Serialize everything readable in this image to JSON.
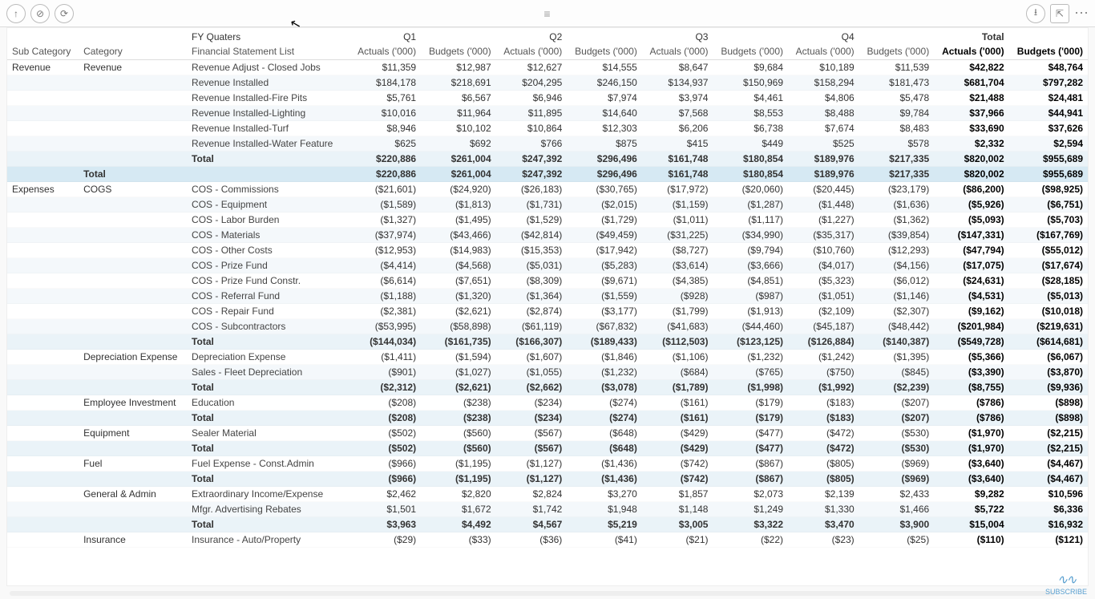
{
  "toolbar": {
    "up_icon": "↑",
    "refresh_icon": "⟳",
    "back_icon": "⊘",
    "drag_handle": "≡",
    "download_icon": "⭳",
    "popout_icon": "⇱",
    "more_icon": "⋯"
  },
  "header": {
    "fy_label": "FY Quaters",
    "fin_label": "Financial Statement List",
    "sub_category": "Sub Category",
    "category": "Category",
    "q1": "Q1",
    "q2": "Q2",
    "q3": "Q3",
    "q4": "Q4",
    "total": "Total",
    "actuals": "Actuals ('000)",
    "budgets": "Budgets ('000)"
  },
  "total_label": "Total",
  "groups": [
    {
      "sub": "Revenue",
      "categories": [
        {
          "cat": "Revenue",
          "rows": [
            {
              "name": "Revenue Adjust - Closed Jobs",
              "q1a": "$11,359",
              "q1b": "$12,987",
              "q2a": "$12,627",
              "q2b": "$14,555",
              "q3a": "$8,647",
              "q3b": "$9,684",
              "q4a": "$10,189",
              "q4b": "$11,539",
              "ta": "$42,822",
              "tb": "$48,764"
            },
            {
              "name": "Revenue Installed",
              "q1a": "$184,178",
              "q1b": "$218,691",
              "q2a": "$204,295",
              "q2b": "$246,150",
              "q3a": "$134,937",
              "q3b": "$150,969",
              "q4a": "$158,294",
              "q4b": "$181,473",
              "ta": "$681,704",
              "tb": "$797,282"
            },
            {
              "name": "Revenue Installed-Fire Pits",
              "q1a": "$5,761",
              "q1b": "$6,567",
              "q2a": "$6,946",
              "q2b": "$7,974",
              "q3a": "$3,974",
              "q3b": "$4,461",
              "q4a": "$4,806",
              "q4b": "$5,478",
              "ta": "$21,488",
              "tb": "$24,481"
            },
            {
              "name": "Revenue Installed-Lighting",
              "q1a": "$10,016",
              "q1b": "$11,964",
              "q2a": "$11,895",
              "q2b": "$14,640",
              "q3a": "$7,568",
              "q3b": "$8,553",
              "q4a": "$8,488",
              "q4b": "$9,784",
              "ta": "$37,966",
              "tb": "$44,941"
            },
            {
              "name": "Revenue Installed-Turf",
              "q1a": "$8,946",
              "q1b": "$10,102",
              "q2a": "$10,864",
              "q2b": "$12,303",
              "q3a": "$6,206",
              "q3b": "$6,738",
              "q4a": "$7,674",
              "q4b": "$8,483",
              "ta": "$33,690",
              "tb": "$37,626"
            },
            {
              "name": "Revenue Installed-Water Feature",
              "q1a": "$625",
              "q1b": "$692",
              "q2a": "$766",
              "q2b": "$875",
              "q3a": "$415",
              "q3b": "$449",
              "q4a": "$525",
              "q4b": "$578",
              "ta": "$2,332",
              "tb": "$2,594"
            }
          ],
          "total": {
            "q1a": "$220,886",
            "q1b": "$261,004",
            "q2a": "$247,392",
            "q2b": "$296,496",
            "q3a": "$161,748",
            "q3b": "$180,854",
            "q4a": "$189,976",
            "q4b": "$217,335",
            "ta": "$820,002",
            "tb": "$955,689"
          }
        }
      ],
      "total": {
        "q1a": "$220,886",
        "q1b": "$261,004",
        "q2a": "$247,392",
        "q2b": "$296,496",
        "q3a": "$161,748",
        "q3b": "$180,854",
        "q4a": "$189,976",
        "q4b": "$217,335",
        "ta": "$820,002",
        "tb": "$955,689"
      }
    },
    {
      "sub": "Expenses",
      "categories": [
        {
          "cat": "COGS",
          "rows": [
            {
              "name": "COS - Commissions",
              "q1a": "($21,601)",
              "q1b": "($24,920)",
              "q2a": "($26,183)",
              "q2b": "($30,765)",
              "q3a": "($17,972)",
              "q3b": "($20,060)",
              "q4a": "($20,445)",
              "q4b": "($23,179)",
              "ta": "($86,200)",
              "tb": "($98,925)"
            },
            {
              "name": "COS - Equipment",
              "q1a": "($1,589)",
              "q1b": "($1,813)",
              "q2a": "($1,731)",
              "q2b": "($2,015)",
              "q3a": "($1,159)",
              "q3b": "($1,287)",
              "q4a": "($1,448)",
              "q4b": "($1,636)",
              "ta": "($5,926)",
              "tb": "($6,751)"
            },
            {
              "name": "COS - Labor Burden",
              "q1a": "($1,327)",
              "q1b": "($1,495)",
              "q2a": "($1,529)",
              "q2b": "($1,729)",
              "q3a": "($1,011)",
              "q3b": "($1,117)",
              "q4a": "($1,227)",
              "q4b": "($1,362)",
              "ta": "($5,093)",
              "tb": "($5,703)"
            },
            {
              "name": "COS - Materials",
              "q1a": "($37,974)",
              "q1b": "($43,466)",
              "q2a": "($42,814)",
              "q2b": "($49,459)",
              "q3a": "($31,225)",
              "q3b": "($34,990)",
              "q4a": "($35,317)",
              "q4b": "($39,854)",
              "ta": "($147,331)",
              "tb": "($167,769)"
            },
            {
              "name": "COS - Other Costs",
              "q1a": "($12,953)",
              "q1b": "($14,983)",
              "q2a": "($15,353)",
              "q2b": "($17,942)",
              "q3a": "($8,727)",
              "q3b": "($9,794)",
              "q4a": "($10,760)",
              "q4b": "($12,293)",
              "ta": "($47,794)",
              "tb": "($55,012)"
            },
            {
              "name": "COS - Prize Fund",
              "q1a": "($4,414)",
              "q1b": "($4,568)",
              "q2a": "($5,031)",
              "q2b": "($5,283)",
              "q3a": "($3,614)",
              "q3b": "($3,666)",
              "q4a": "($4,017)",
              "q4b": "($4,156)",
              "ta": "($17,075)",
              "tb": "($17,674)"
            },
            {
              "name": "COS - Prize Fund Constr.",
              "q1a": "($6,614)",
              "q1b": "($7,651)",
              "q2a": "($8,309)",
              "q2b": "($9,671)",
              "q3a": "($4,385)",
              "q3b": "($4,851)",
              "q4a": "($5,323)",
              "q4b": "($6,012)",
              "ta": "($24,631)",
              "tb": "($28,185)"
            },
            {
              "name": "COS - Referral Fund",
              "q1a": "($1,188)",
              "q1b": "($1,320)",
              "q2a": "($1,364)",
              "q2b": "($1,559)",
              "q3a": "($928)",
              "q3b": "($987)",
              "q4a": "($1,051)",
              "q4b": "($1,146)",
              "ta": "($4,531)",
              "tb": "($5,013)"
            },
            {
              "name": "COS - Repair Fund",
              "q1a": "($2,381)",
              "q1b": "($2,621)",
              "q2a": "($2,874)",
              "q2b": "($3,177)",
              "q3a": "($1,799)",
              "q3b": "($1,913)",
              "q4a": "($2,109)",
              "q4b": "($2,307)",
              "ta": "($9,162)",
              "tb": "($10,018)"
            },
            {
              "name": "COS - Subcontractors",
              "q1a": "($53,995)",
              "q1b": "($58,898)",
              "q2a": "($61,119)",
              "q2b": "($67,832)",
              "q3a": "($41,683)",
              "q3b": "($44,460)",
              "q4a": "($45,187)",
              "q4b": "($48,442)",
              "ta": "($201,984)",
              "tb": "($219,631)"
            }
          ],
          "total": {
            "q1a": "($144,034)",
            "q1b": "($161,735)",
            "q2a": "($166,307)",
            "q2b": "($189,433)",
            "q3a": "($112,503)",
            "q3b": "($123,125)",
            "q4a": "($126,884)",
            "q4b": "($140,387)",
            "ta": "($549,728)",
            "tb": "($614,681)"
          }
        },
        {
          "cat": "Depreciation Expense",
          "rows": [
            {
              "name": "Depreciation Expense",
              "q1a": "($1,411)",
              "q1b": "($1,594)",
              "q2a": "($1,607)",
              "q2b": "($1,846)",
              "q3a": "($1,106)",
              "q3b": "($1,232)",
              "q4a": "($1,242)",
              "q4b": "($1,395)",
              "ta": "($5,366)",
              "tb": "($6,067)"
            },
            {
              "name": "Sales - Fleet Depreciation",
              "q1a": "($901)",
              "q1b": "($1,027)",
              "q2a": "($1,055)",
              "q2b": "($1,232)",
              "q3a": "($684)",
              "q3b": "($765)",
              "q4a": "($750)",
              "q4b": "($845)",
              "ta": "($3,390)",
              "tb": "($3,870)"
            }
          ],
          "total": {
            "q1a": "($2,312)",
            "q1b": "($2,621)",
            "q2a": "($2,662)",
            "q2b": "($3,078)",
            "q3a": "($1,789)",
            "q3b": "($1,998)",
            "q4a": "($1,992)",
            "q4b": "($2,239)",
            "ta": "($8,755)",
            "tb": "($9,936)"
          }
        },
        {
          "cat": "Employee Investment",
          "rows": [
            {
              "name": "Education",
              "q1a": "($208)",
              "q1b": "($238)",
              "q2a": "($234)",
              "q2b": "($274)",
              "q3a": "($161)",
              "q3b": "($179)",
              "q4a": "($183)",
              "q4b": "($207)",
              "ta": "($786)",
              "tb": "($898)"
            }
          ],
          "total": {
            "q1a": "($208)",
            "q1b": "($238)",
            "q2a": "($234)",
            "q2b": "($274)",
            "q3a": "($161)",
            "q3b": "($179)",
            "q4a": "($183)",
            "q4b": "($207)",
            "ta": "($786)",
            "tb": "($898)"
          }
        },
        {
          "cat": "Equipment",
          "rows": [
            {
              "name": "Sealer Material",
              "q1a": "($502)",
              "q1b": "($560)",
              "q2a": "($567)",
              "q2b": "($648)",
              "q3a": "($429)",
              "q3b": "($477)",
              "q4a": "($472)",
              "q4b": "($530)",
              "ta": "($1,970)",
              "tb": "($2,215)"
            }
          ],
          "total": {
            "q1a": "($502)",
            "q1b": "($560)",
            "q2a": "($567)",
            "q2b": "($648)",
            "q3a": "($429)",
            "q3b": "($477)",
            "q4a": "($472)",
            "q4b": "($530)",
            "ta": "($1,970)",
            "tb": "($2,215)"
          }
        },
        {
          "cat": "Fuel",
          "rows": [
            {
              "name": "Fuel Expense - Const.Admin",
              "q1a": "($966)",
              "q1b": "($1,195)",
              "q2a": "($1,127)",
              "q2b": "($1,436)",
              "q3a": "($742)",
              "q3b": "($867)",
              "q4a": "($805)",
              "q4b": "($969)",
              "ta": "($3,640)",
              "tb": "($4,467)"
            }
          ],
          "total": {
            "q1a": "($966)",
            "q1b": "($1,195)",
            "q2a": "($1,127)",
            "q2b": "($1,436)",
            "q3a": "($742)",
            "q3b": "($867)",
            "q4a": "($805)",
            "q4b": "($969)",
            "ta": "($3,640)",
            "tb": "($4,467)"
          }
        },
        {
          "cat": "General & Admin",
          "rows": [
            {
              "name": "Extraordinary Income/Expense",
              "q1a": "$2,462",
              "q1b": "$2,820",
              "q2a": "$2,824",
              "q2b": "$3,270",
              "q3a": "$1,857",
              "q3b": "$2,073",
              "q4a": "$2,139",
              "q4b": "$2,433",
              "ta": "$9,282",
              "tb": "$10,596"
            },
            {
              "name": "Mfgr. Advertising Rebates",
              "q1a": "$1,501",
              "q1b": "$1,672",
              "q2a": "$1,742",
              "q2b": "$1,948",
              "q3a": "$1,148",
              "q3b": "$1,249",
              "q4a": "$1,330",
              "q4b": "$1,466",
              "ta": "$5,722",
              "tb": "$6,336"
            }
          ],
          "total": {
            "q1a": "$3,963",
            "q1b": "$4,492",
            "q2a": "$4,567",
            "q2b": "$5,219",
            "q3a": "$3,005",
            "q3b": "$3,322",
            "q4a": "$3,470",
            "q4b": "$3,900",
            "ta": "$15,004",
            "tb": "$16,932"
          }
        },
        {
          "cat": "Insurance",
          "rows": [
            {
              "name": "Insurance - Auto/Property",
              "q1a": "($29)",
              "q1b": "($33)",
              "q2a": "($36)",
              "q2b": "($41)",
              "q3a": "($21)",
              "q3b": "($22)",
              "q4a": "($23)",
              "q4b": "($25)",
              "ta": "($110)",
              "tb": "($121)"
            }
          ],
          "total": null
        }
      ],
      "total": null
    }
  ],
  "corner": {
    "logo": "∿∿",
    "label": "SUBSCRIBE"
  }
}
